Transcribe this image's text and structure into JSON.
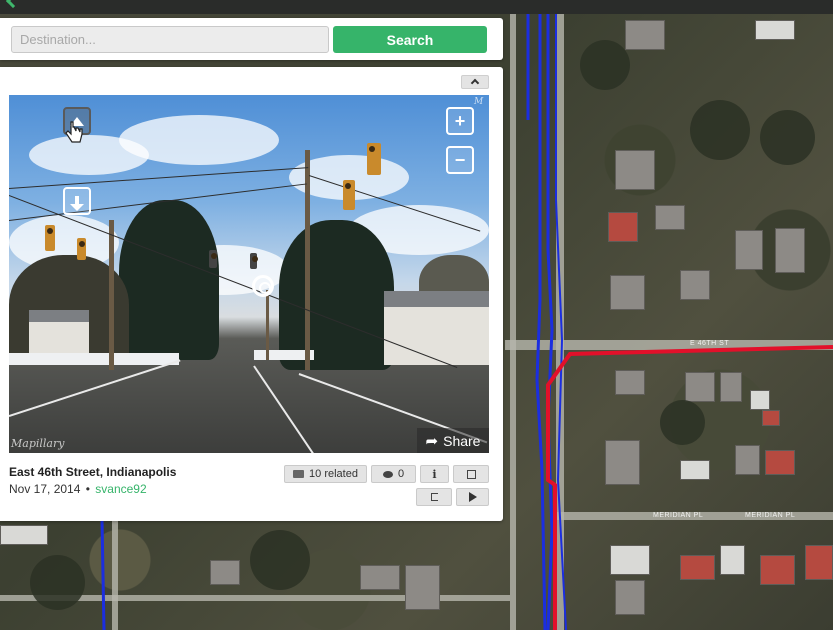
{
  "search": {
    "placeholder": "Destination...",
    "button_label": "Search"
  },
  "viewer": {
    "watermark": "Mapillary",
    "watermark_top": "M",
    "share_label": "Share",
    "street_name": "East 46th Street, Indianapolis",
    "date": "Nov 17, 2014",
    "separator": "•",
    "user": "svance92",
    "related_label": "10 related",
    "comments_count": "0",
    "info_label": "i"
  },
  "map": {
    "street_labels": [
      "E 46TH ST",
      "MERIDIAN PL",
      "MERIDIAN PL"
    ],
    "colors": {
      "blue_track": "#1b2ee0",
      "red_track": "#e2102a",
      "accent": "#36b46a"
    }
  }
}
